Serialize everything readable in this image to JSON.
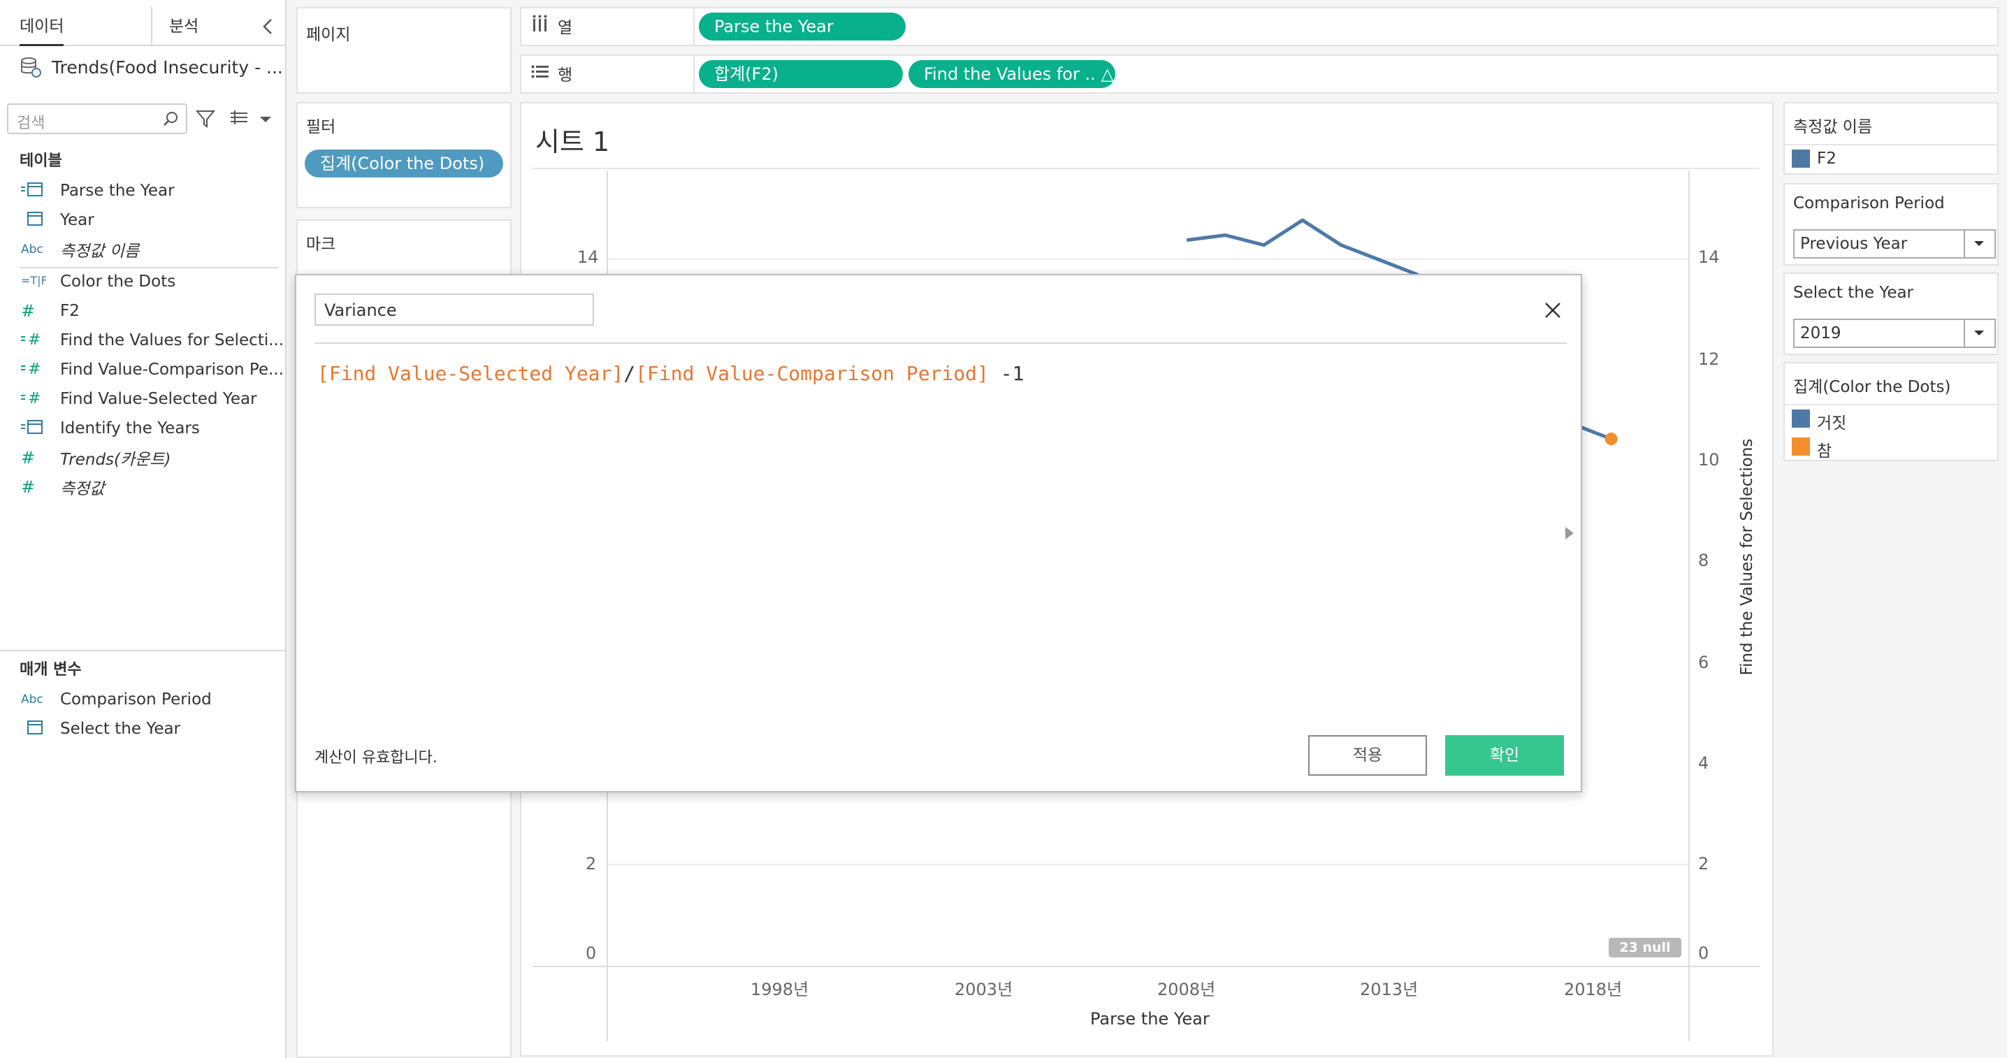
{
  "data_pane": {
    "tabs": [
      "데이터",
      "분석"
    ],
    "datasource": "Trends(Food Insecurity - ...",
    "search_placeholder": "검색",
    "tables_title": "테이블",
    "fields": [
      {
        "icon": "date-icon",
        "name": "Parse the Year"
      },
      {
        "icon": "date-icon",
        "name": "Year"
      },
      {
        "icon": "Abc",
        "name": "측정값 이름"
      },
      {
        "icon": "calculated-boolean-icon",
        "name": "Color the Dots"
      },
      {
        "icon": "#",
        "name": "F2"
      },
      {
        "icon": "calculated-number-icon",
        "name": "Find the Values for Selecti..."
      },
      {
        "icon": "calculated-number-icon",
        "name": "Find Value-Comparison Pe..."
      },
      {
        "icon": "calculated-number-icon",
        "name": "Find Value-Selected Year"
      },
      {
        "icon": "calculated-date-icon",
        "name": "Identify the Years"
      },
      {
        "icon": "#",
        "name": "Trends(카운트)"
      },
      {
        "icon": "#",
        "name": "측정값"
      }
    ],
    "params_title": "매개 변수",
    "params": [
      {
        "icon": "Abc",
        "name": "Comparison Period"
      },
      {
        "icon": "date-icon",
        "name": "Select the Year"
      }
    ]
  },
  "cards": {
    "pages": "페이지",
    "filters": "필터",
    "filter_pill": "집계(Color the Dots)",
    "marks": "마크"
  },
  "shelves": {
    "columns_label": "열",
    "rows_label": "행",
    "columns_pill": "Parse the Year",
    "rows_pills": [
      "합계(F2)",
      "Find the Values for .. △"
    ]
  },
  "sheet": {
    "title": "시트 1",
    "left_axis_ticks": [
      "14",
      "2",
      "0"
    ],
    "right_axis_ticks": [
      "14",
      "12",
      "10",
      "8",
      "6",
      "4",
      "2",
      "0"
    ],
    "right_axis_title": "Find the Values for Selections",
    "x_ticks": [
      "1998년",
      "2003년",
      "2008년",
      "2013년",
      "2018년"
    ],
    "x_axis_title": "Parse the Year",
    "null_badge": "23 null"
  },
  "chart_data": {
    "type": "line",
    "x": [
      "2008",
      "2009",
      "2010",
      "2011",
      "2012",
      "2013",
      "2014",
      "2018",
      "2019"
    ],
    "values": [
      14.6,
      14.7,
      14.5,
      15.0,
      14.5,
      14.2,
      13.9,
      10.9,
      10.6
    ],
    "xlabel": "Parse the Year",
    "ylabel": "Find the Values for Selections",
    "ylim": [
      0,
      16
    ]
  },
  "right_panel": {
    "measure_names": {
      "title": "측정값 이름",
      "items": [
        {
          "label": "F2",
          "color": "#4e79a7"
        }
      ]
    },
    "comparison_period": {
      "title": "Comparison Period",
      "value": "Previous Year"
    },
    "select_year": {
      "title": "Select the Year",
      "value": "2019"
    },
    "color_dots": {
      "title": "집계(Color the Dots)",
      "items": [
        {
          "label": "거짓",
          "color": "#4e79a7"
        },
        {
          "label": "참",
          "color": "#f28e2b"
        }
      ]
    }
  },
  "dialog": {
    "calc_name": "Variance",
    "formula": {
      "field1": "[Find Value-Selected Year]",
      "op1": "/",
      "field2": "[Find Value-Comparison Period]",
      "tail": " -1"
    },
    "status": "계산이 유효합니다.",
    "apply": "적용",
    "ok": "확인"
  }
}
